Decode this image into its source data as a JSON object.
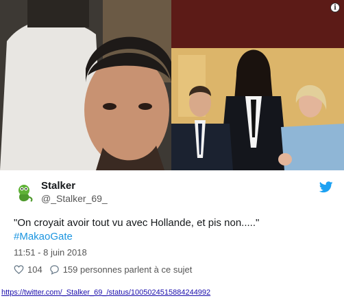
{
  "tweet": {
    "display_name": "Stalker",
    "handle": "@_Stalker_69_",
    "text": "\"On croyait avoir tout vu avec Hollande, et pis non.....\"",
    "hashtag": "#MakaoGate",
    "timestamp": "11:51 - 8 juin 2018",
    "likes": "104",
    "replies_label": "159 personnes parlent à ce sujet"
  },
  "source_link": "https://twitter.com/_Stalker_69_/status/1005024515884244992",
  "info_badge": "i",
  "colors": {
    "twitter_blue": "#1da1f2",
    "hashtag": "#1b95e0",
    "link": "#1a0dab"
  },
  "icons": [
    "info-icon",
    "avatar-gecko-icon",
    "twitter-bird-icon",
    "heart-icon",
    "speech-bubble-icon"
  ]
}
